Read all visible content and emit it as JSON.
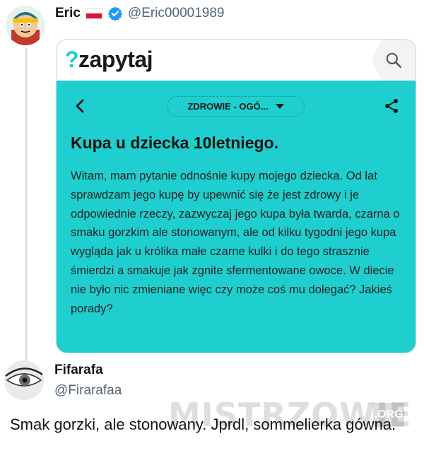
{
  "tweet1": {
    "name": "Eric",
    "handle": "@Eric00001989",
    "flag_icon": "poland-flag-icon",
    "verified_icon": "verified-badge-icon",
    "verified_color": "#1d9bf0"
  },
  "quoted_image": {
    "logo_symbol": "?",
    "logo_text": "zapytaj",
    "accent_color": "#1fcfcf",
    "search_icon": "search-icon",
    "back_icon": "chevron-left-icon",
    "category": "ZDROWIE - OGÓ...",
    "share_icon": "share-icon",
    "question_title": "Kupa u dziecka 10letniego.",
    "question_body": "Witam, mam pytanie odnośnie kupy mojego dziecka. Od lat sprawdzam jego kupę by upewnić się że jest zdrowy i je odpowiednie rzeczy, zazwyczaj jego kupa była twarda, czarna o smaku gorzkim ale stonowanym, ale od kilku tygodni jego kupa wygląda jak u królika małe czarne kulki i do tego strasznie śmierdzi a smakuje jak zgnite sfermentowane owoce. W diecie nie było nic zmieniane więc czy może coś mu dolegać? Jakieś porady?"
  },
  "tweet2": {
    "name": "Fifarafa",
    "handle": "@Firarafaa",
    "text": "Smak gorzki, ale stonowany. Jprdl, sommelierka gówna."
  },
  "watermark": {
    "text": "MISTRZOWIE",
    "suffix": ".ORG"
  }
}
